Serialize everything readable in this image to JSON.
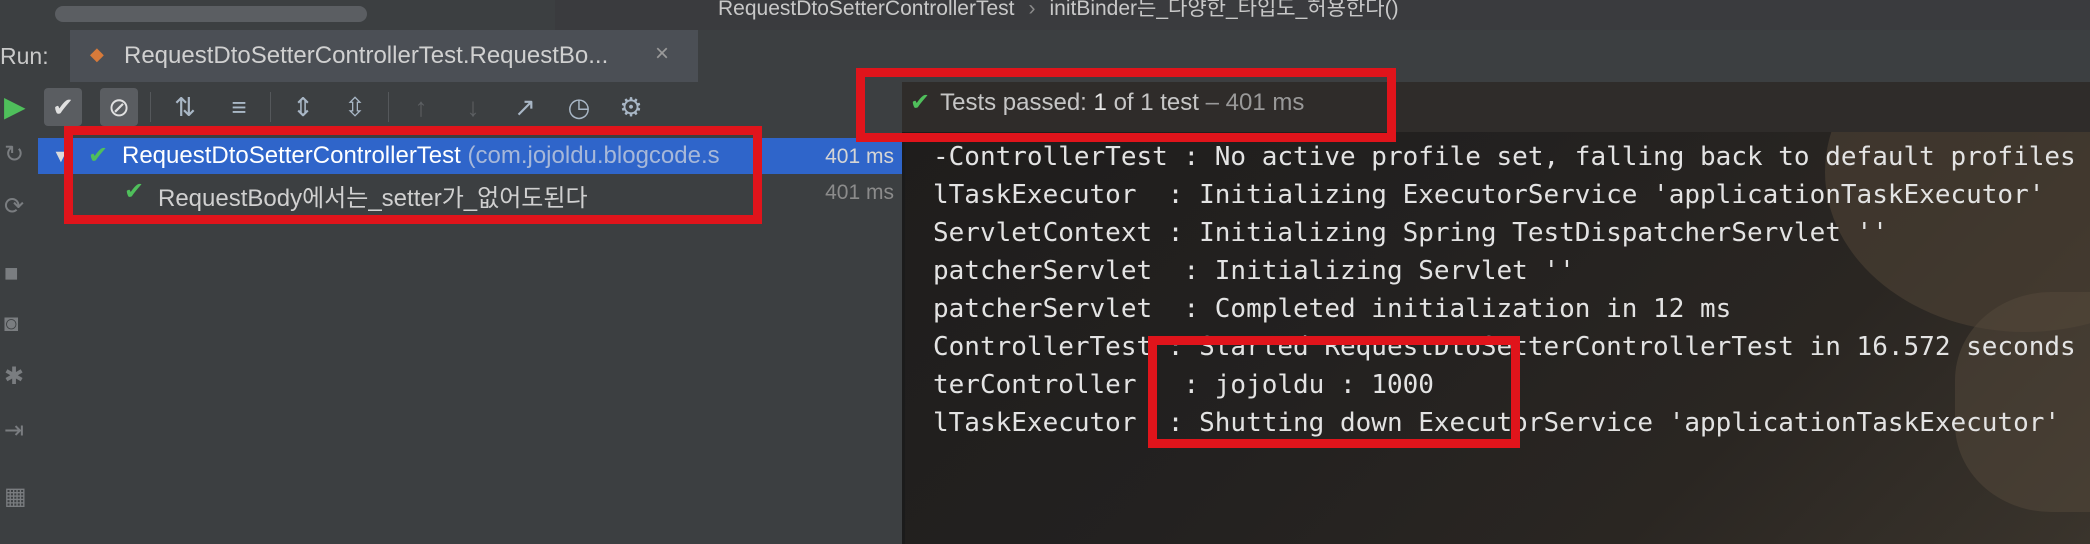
{
  "breadcrumb": {
    "class_name": "RequestDtoSetterControllerTest",
    "separator": "›",
    "method_name": "initBinder는_다양한_타입도_허용한다()"
  },
  "run_panel": {
    "label": "Run:",
    "tab_title": "RequestDtoSetterControllerTest.RequestBo...",
    "tab_close": "×"
  },
  "status": {
    "prefix": "Tests passed:",
    "passed": "1",
    "of_text": "of 1 test",
    "dash": "–",
    "duration": "401 ms"
  },
  "test_tree": {
    "root": {
      "name": "RequestDtoSetterControllerTest",
      "package": "(com.jojoldu.blogcode.s",
      "time": "401 ms"
    },
    "child": {
      "name": "RequestBody에서는_setter가_없어도된다",
      "time": "401 ms"
    }
  },
  "console": {
    "lines": [
      "-ControllerTest : No active profile set, falling back to default profiles",
      "lTaskExecutor  : Initializing ExecutorService 'applicationTaskExecutor'",
      "ServletContext : Initializing Spring TestDispatcherServlet ''",
      "patcherServlet  : Initializing Servlet ''",
      "patcherServlet  : Completed initialization in 12 ms",
      "ControllerTest : Started RequestDtoSetterControllerTest in 16.572 seconds",
      "terController   : jojoldu : 1000",
      "lTaskExecutor  : Shutting down ExecutorService 'applicationTaskExecutor'"
    ]
  },
  "colors": {
    "pass_green": "#4fbf5b",
    "selection_blue": "#2f65ca",
    "highlight_red": "#e0141b"
  }
}
